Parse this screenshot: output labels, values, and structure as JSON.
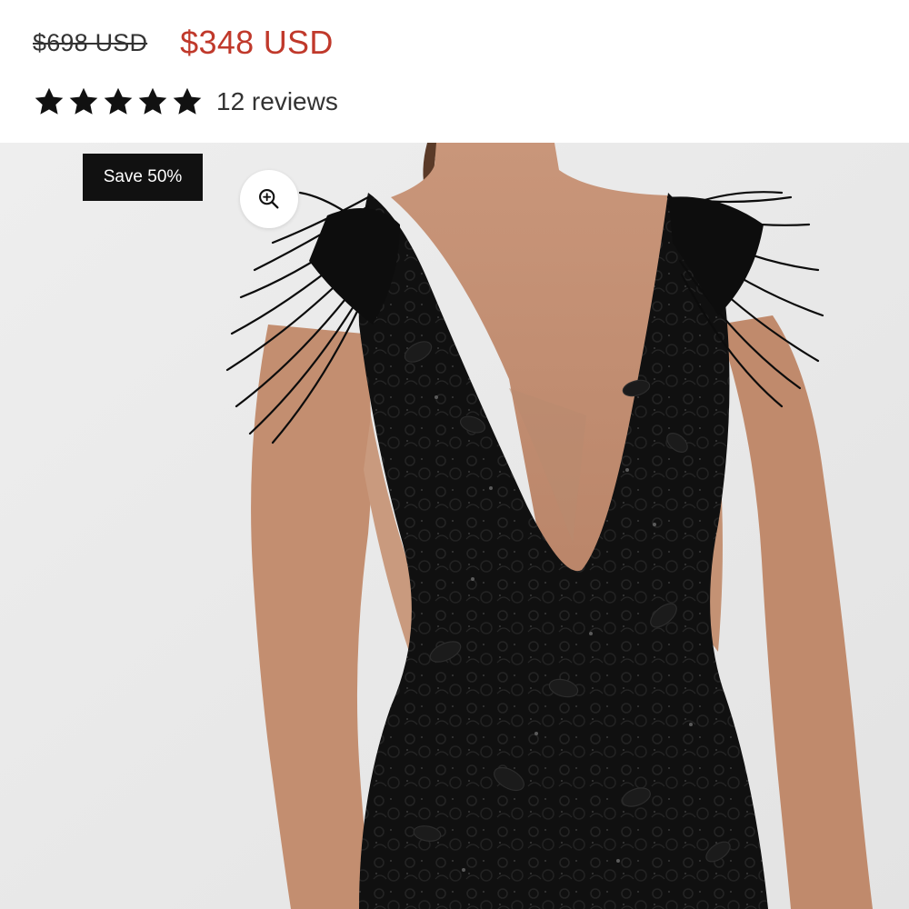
{
  "pricing": {
    "compare_at_price": "$698 USD",
    "sale_price": "$348 USD",
    "sale_color": "#c0392b"
  },
  "rating": {
    "stars": 5,
    "max_stars": 5,
    "review_count_label": "12 reviews"
  },
  "media": {
    "badge_label": "Save 50%",
    "zoom_icon": "zoom-in-icon",
    "image_subject": "black lace feather-shoulder dress"
  },
  "colors": {
    "badge_bg": "#111111",
    "badge_text": "#ffffff",
    "text": "#333333",
    "image_bg": "#ececec"
  }
}
